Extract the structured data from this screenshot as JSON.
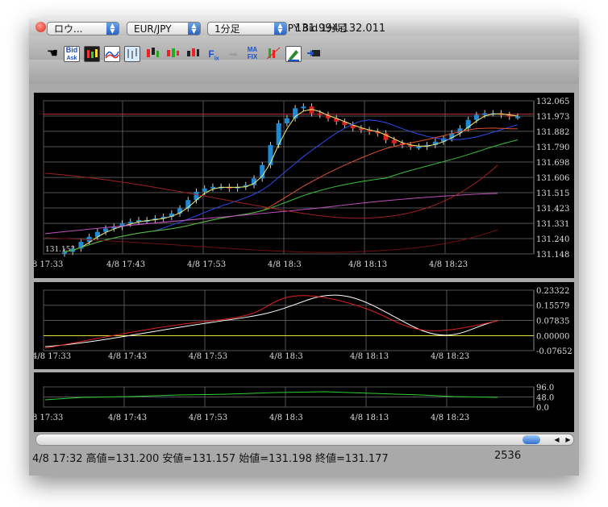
{
  "window": {
    "title": "EUR/JPY Bid 1分足"
  },
  "toolbar": {
    "order_type": "ロウ...",
    "pair": "EUR/JPY",
    "timeframe": "1分足",
    "price_range": "131.994-132.011",
    "icons": [
      "hand-tool-icon",
      "bid-ask-icon",
      "candle-color-icon",
      "moving-average-icon",
      "bar-chart-icon",
      "candlestick-icon",
      "candlestick2-icon",
      "candlestick3-icon",
      "fix-icon",
      "disabled-arrow-icon",
      "ma-fix-icon",
      "trend-icon",
      "pencil-icon",
      "export-icon"
    ]
  },
  "status": {
    "info": "4/8 17:32 高値=131.200 安値=131.157 始値=131.198 終値=131.177",
    "count": "2536"
  },
  "chart_data": [
    {
      "type": "candlestick",
      "series": [
        {
          "name": "EUR/JPY",
          "values": [
            131.16,
            131.18,
            131.22,
            131.25,
            131.28,
            131.3,
            131.31,
            131.33,
            131.34,
            131.35,
            131.35,
            131.36,
            131.37,
            131.39,
            131.42,
            131.47,
            131.52,
            131.54,
            131.55,
            131.55,
            131.54,
            131.55,
            131.56,
            131.6,
            131.68,
            131.8,
            131.93,
            131.96,
            132.02,
            132.03,
            131.99,
            131.98,
            131.96,
            131.94,
            131.92,
            131.9,
            131.89,
            131.88,
            131.87,
            131.83,
            131.81,
            131.8,
            131.79,
            131.79,
            131.8,
            131.82,
            131.84,
            131.87,
            131.9,
            131.95,
            131.98,
            131.99,
            131.99,
            131.98,
            131.97,
            131.97
          ]
        }
      ],
      "x_tick_labels": [
        "8 17:33",
        "4/8 17:43",
        "4/8 17:53",
        "4/8 18:3",
        "4/8 18:13",
        "4/8 18:23"
      ],
      "y_tick_labels": [
        "132.065",
        "131.973",
        "131.882",
        "131.790",
        "131.698",
        "131.606",
        "131.515",
        "131.423",
        "131.331",
        "131.240",
        "131.148"
      ],
      "ylim": [
        131.148,
        132.065
      ],
      "corner_label": "131.153",
      "grid": true
    },
    {
      "type": "line",
      "series": [],
      "x_tick_labels": [
        "4/8 17:33",
        "4/8 17:43",
        "4/8 17:53",
        "4/8 18:3",
        "4/8 18:13",
        "4/8 18:23"
      ],
      "y_tick_labels": [
        "0.23322",
        "0.15579",
        "0.07835",
        "0.00000",
        "-0.07652"
      ],
      "ylim": [
        -0.07652,
        0.23322
      ],
      "grid": true
    },
    {
      "type": "line",
      "series": [],
      "x_tick_labels": [
        "8 17:33",
        "4/8 17:43",
        "4/8 17:53",
        "4/8 18:3",
        "4/8 18:13",
        "4/8 18:23"
      ],
      "y_tick_labels": [
        "96.0",
        "48.0",
        "0.0"
      ],
      "ylim": [
        0,
        96
      ],
      "grid": true
    }
  ]
}
